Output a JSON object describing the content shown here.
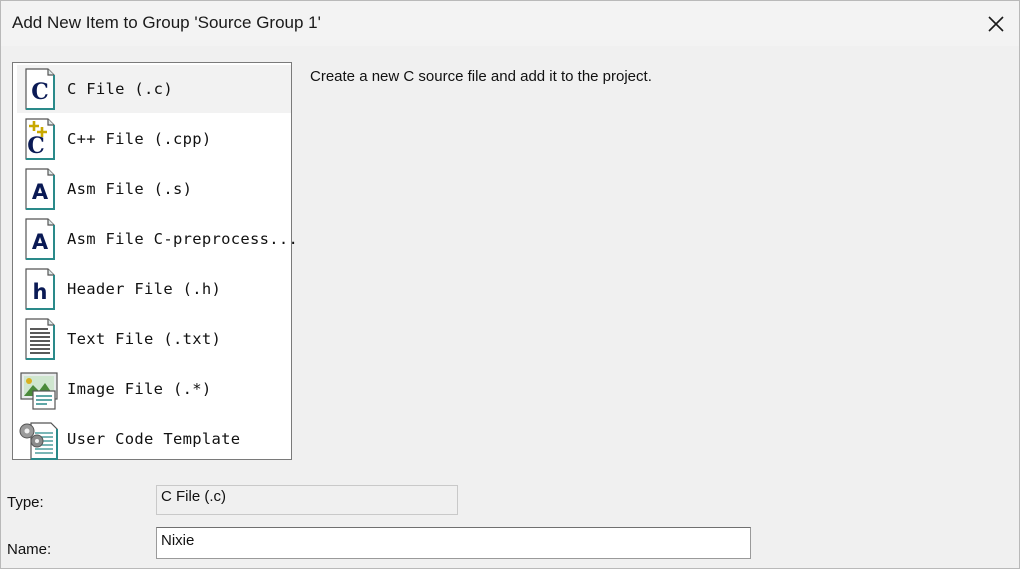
{
  "window": {
    "title": "Add New Item to Group 'Source Group 1'",
    "close_icon": "close-icon"
  },
  "items": [
    {
      "label": "C File (.c)",
      "icon": "c-file-icon",
      "selected": true
    },
    {
      "label": "C++ File (.cpp)",
      "icon": "cpp-file-icon",
      "selected": false
    },
    {
      "label": "Asm File (.s)",
      "icon": "asm-file-icon",
      "selected": false
    },
    {
      "label": "Asm File C-preprocess...",
      "icon": "asm-file-preprocess-icon",
      "selected": false
    },
    {
      "label": "Header File (.h)",
      "icon": "header-file-icon",
      "selected": false
    },
    {
      "label": "Text File (.txt)",
      "icon": "text-file-icon",
      "selected": false
    },
    {
      "label": "Image File (.*)",
      "icon": "image-file-icon",
      "selected": false
    },
    {
      "label": "User Code Template",
      "icon": "user-code-template-icon",
      "selected": false
    }
  ],
  "description": "Create a new C source file and add it to the project.",
  "form": {
    "type_label": "Type:",
    "type_value": "C File (.c)",
    "name_label": "Name:",
    "name_value": "Nixie"
  },
  "colors": {
    "dialog_bg": "#f0f0f0",
    "list_bg": "#ffffff",
    "selection_bg": "#f2f2f2",
    "icon_letter": "#0a1a55",
    "icon_accent": "#2a8a8a"
  }
}
